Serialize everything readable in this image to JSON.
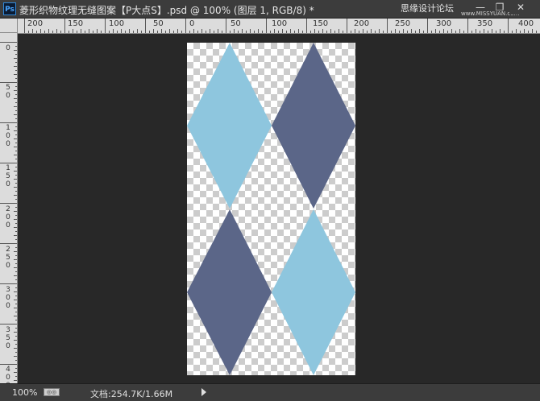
{
  "window": {
    "app_icon": "Ps",
    "title": "菱形织物纹理无缝图案【P大点S】.psd @ 100% (图层 1, RGB/8) *",
    "watermark": "思缘设计论坛",
    "watermark_small": "www.MISSYUAN.com",
    "minimize": "—",
    "maximize": "❐",
    "close": "✕"
  },
  "ruler_top": {
    "labels": [
      "200",
      "150",
      "100",
      "50",
      "0",
      "50",
      "100",
      "150",
      "200",
      "250",
      "300",
      "350",
      "400"
    ]
  },
  "ruler_left": {
    "labels": [
      "0",
      "50",
      "100",
      "150",
      "200",
      "250",
      "300",
      "350",
      "400"
    ]
  },
  "canvas": {
    "colors": {
      "light_blue": "#8ec6de",
      "slate_blue": "#5b6688",
      "transparency_check": "#cccccc"
    },
    "diamonds": [
      {
        "color": "light_blue"
      },
      {
        "color": "slate_blue"
      },
      {
        "color": "slate_blue"
      },
      {
        "color": "light_blue"
      }
    ]
  },
  "status": {
    "zoom": "100%",
    "icon": "status-options-icon",
    "doc_info": "文档:254.7K/1.66M"
  }
}
